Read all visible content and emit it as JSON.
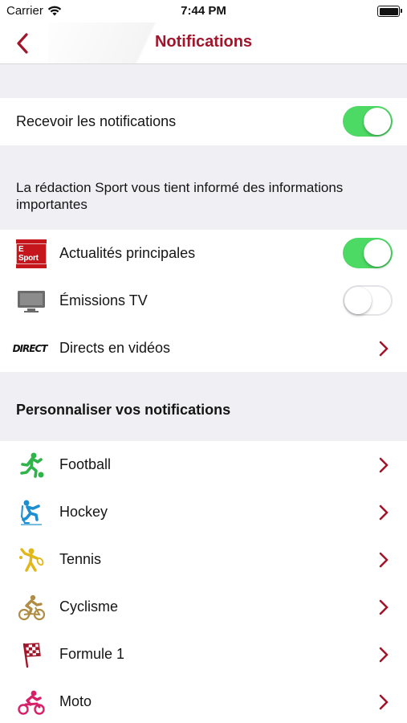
{
  "status_bar": {
    "carrier": "Carrier",
    "time": "7:44 PM"
  },
  "nav": {
    "title": "Notifications"
  },
  "receive": {
    "label": "Recevoir les notifications",
    "enabled": true
  },
  "info_header": "La rédaction Sport vous tient informé des informations importantes",
  "main_items": [
    {
      "label": "Actualités principales",
      "icon": "e-sport-logo-icon",
      "icon_text": "E Sport",
      "control": "toggle",
      "enabled": true
    },
    {
      "label": "Émissions TV",
      "icon": "tv-icon",
      "control": "toggle",
      "enabled": false
    },
    {
      "label": "Directs en vidéos",
      "icon": "direct-logo-icon",
      "icon_text": "DIRECT",
      "control": "chevron"
    }
  ],
  "personalize_header": "Personnaliser vos notifications",
  "sports": [
    {
      "label": "Football",
      "icon": "football-icon",
      "color": "#2fb44a"
    },
    {
      "label": "Hockey",
      "icon": "hockey-icon",
      "color": "#1d8fd0"
    },
    {
      "label": "Tennis",
      "icon": "tennis-icon",
      "color": "#e0b81a"
    },
    {
      "label": "Cyclisme",
      "icon": "cycling-icon",
      "color": "#b08d45"
    },
    {
      "label": "Formule 1",
      "icon": "formula1-flag-icon",
      "color": "#a0162b"
    },
    {
      "label": "Moto",
      "icon": "motorbike-icon",
      "color": "#d8206a"
    }
  ],
  "colors": {
    "accent": "#a0162b",
    "toggle_on": "#4cd964",
    "background": "#efeff4"
  }
}
